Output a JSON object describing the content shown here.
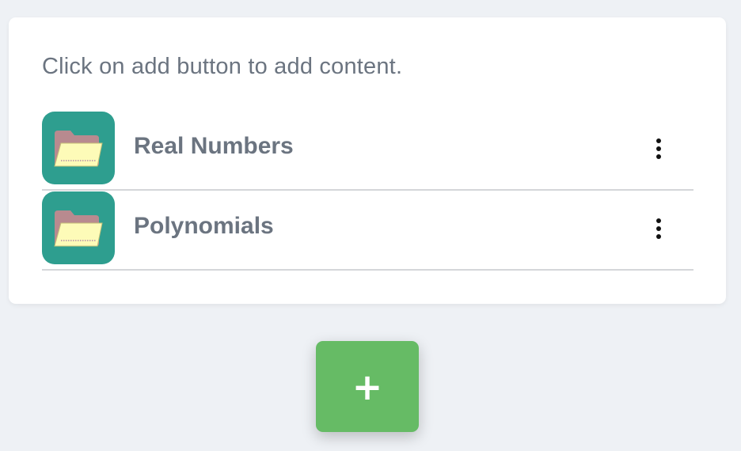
{
  "instruction": "Click on add button to add content.",
  "items": [
    {
      "title": "Real Numbers",
      "icon": "folder-icon",
      "menu_icon": "more-vertical-icon"
    },
    {
      "title": "Polynomials",
      "icon": "folder-icon",
      "menu_icon": "more-vertical-icon"
    }
  ],
  "add_button": {
    "label": "+",
    "icon": "plus-icon",
    "color": "#66bb65"
  },
  "colors": {
    "background": "#eef1f5",
    "card": "#ffffff",
    "tile": "#2e9e8f",
    "text": "#6b7480",
    "divider": "#d4d6d9"
  }
}
